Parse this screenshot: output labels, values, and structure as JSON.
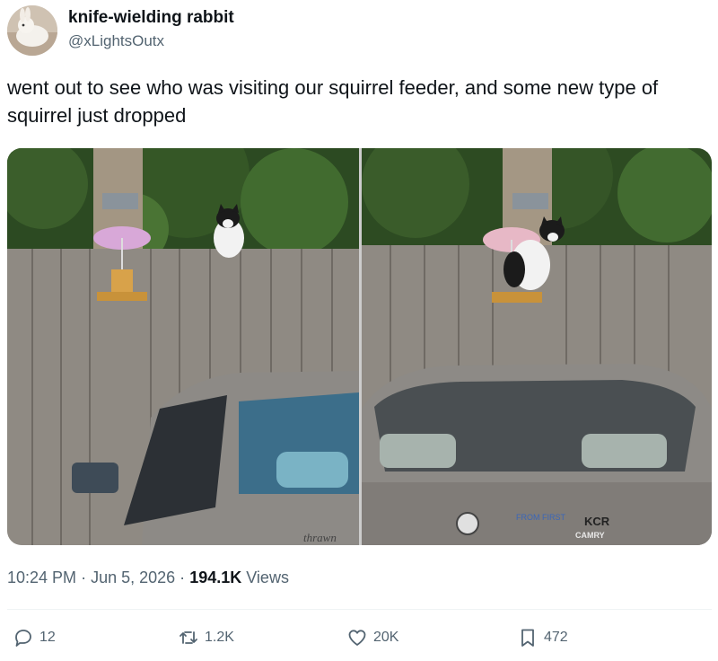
{
  "author": {
    "display_name": "knife-wielding rabbit",
    "handle": "@xLightsOutx"
  },
  "tweet": {
    "text": "went out to see who was visiting our squirrel feeder, and some new type of squirrel just dropped"
  },
  "meta": {
    "time": "10:24 PM",
    "separator": "·",
    "date": "Jun 5, 2026",
    "views_count": "194.1K",
    "views_label": "Views"
  },
  "actions": {
    "replies": "12",
    "reposts": "1.2K",
    "likes": "20K",
    "bookmarks": "472"
  },
  "media": {
    "left_car_text": "thrawn",
    "right_badge": "CAMRY",
    "right_sticker_1": "FROM FIRST",
    "right_sticker_2": "KCR"
  },
  "colors": {
    "text_primary": "#0f1419",
    "text_secondary": "#536471",
    "divider": "#eff3f4"
  },
  "icons": {
    "reply": "speech-bubble-icon",
    "repost": "repost-arrows-icon",
    "like": "heart-icon",
    "bookmark": "bookmark-icon"
  }
}
